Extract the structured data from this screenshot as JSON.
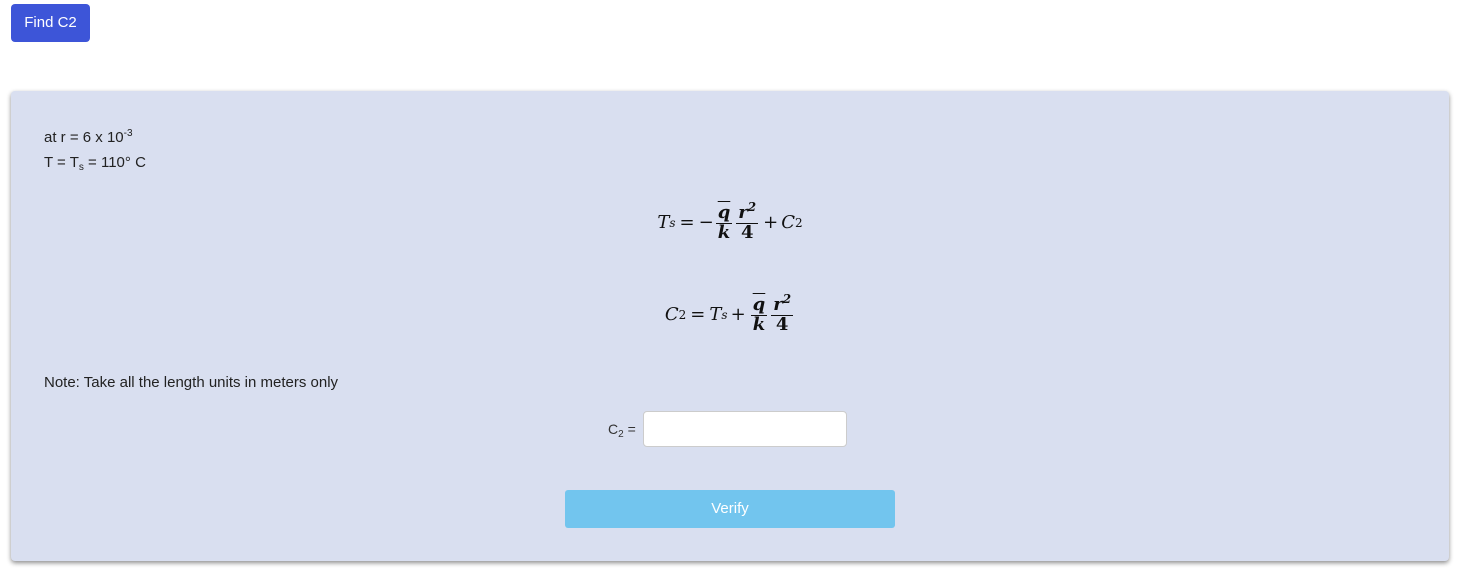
{
  "header": {
    "find_button_label": "Find C2"
  },
  "given": {
    "line1_prefix": "at r = 6 x 10",
    "line1_exponent": "-3",
    "line2_prefix": "T = T",
    "line2_sub": "s",
    "line2_suffix": " = 110° C"
  },
  "equations": {
    "eq1": {
      "lhs": "T",
      "lhs_sub": "s",
      "equals": "=",
      "minus": "−",
      "num1": "q",
      "den1": "k",
      "num2_base": "r",
      "num2_exp": "2",
      "den2": "4",
      "plus": "+",
      "tail": "C",
      "tail_sub": "2"
    },
    "eq2": {
      "lhs": "C",
      "lhs_sub": "2",
      "equals": "=",
      "rhs_var": "T",
      "rhs_sub": "s",
      "plus": "+",
      "num1": "q",
      "den1": "k",
      "num2_base": "r",
      "num2_exp": "2",
      "den2": "4"
    }
  },
  "note": "Note: Take all the length units in meters only",
  "answer": {
    "label": "C",
    "label_sub": "2",
    "label_suffix": " =",
    "value": "",
    "placeholder": ""
  },
  "verify_label": "Verify",
  "colors": {
    "primary_button": "#3d55d8",
    "verify_button": "#72c5ee",
    "panel_bg": "#d9dff0"
  }
}
